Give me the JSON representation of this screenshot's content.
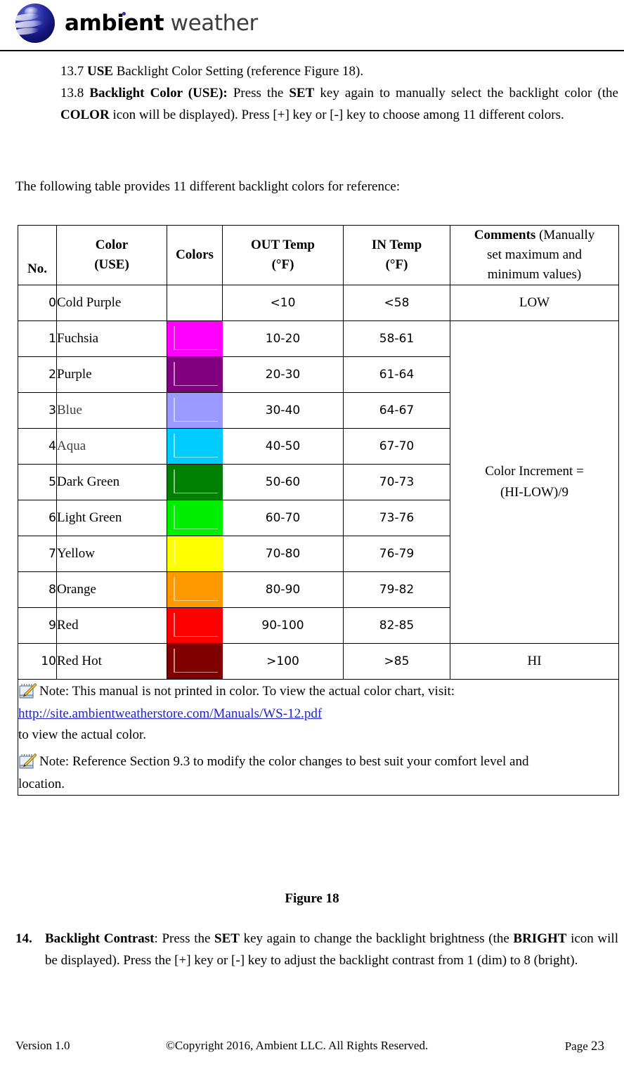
{
  "header": {
    "logo_icon": "ambient-sphere-logo",
    "brand_bold": "ambient",
    "brand_light": " weather"
  },
  "intro": {
    "item_13_7_num": "13.7",
    "item_13_7_bold": "USE",
    "item_13_7_rest": " Backlight Color Setting (reference Figure 18).",
    "item_13_8_num": "13.8",
    "item_13_8_bold": "Backlight Color (USE):",
    "item_13_8_t1": " Press the ",
    "item_13_8_b2": "SET",
    "item_13_8_t2": " key again to manually select the backlight color (the ",
    "item_13_8_b3": "COLOR",
    "item_13_8_t3": " icon will be displayed). Press [+] key or [-] key to choose among 11 different colors.",
    "lead_in": "The following table provides 11 different backlight colors for reference:"
  },
  "table": {
    "headers": {
      "no": "No.",
      "color_line1": "Color",
      "color_line2": "(USE)",
      "colors": "Colors",
      "out_line1": "OUT Temp",
      "out_line2": "(°F)",
      "in_line1": "IN Temp",
      "in_line2": "(°F)",
      "comments_bold": "Comments ",
      "comments_rest_line1": "(Manually",
      "comments_rest_line2": "set maximum and",
      "comments_rest_line3": "minimum values)"
    },
    "rows": [
      {
        "no": "0",
        "name": "Cold Purple",
        "swatch": "",
        "out": "<10",
        "in": "<58",
        "dim": false
      },
      {
        "no": "1",
        "name": "Fuchsia",
        "swatch": "#FF00FF",
        "out": "10-20",
        "in": "58-61",
        "dim": false
      },
      {
        "no": "2",
        "name": "Purple",
        "swatch": "#800080",
        "out": "20-30",
        "in": "61-64",
        "dim": false
      },
      {
        "no": "3",
        "name": "Blue",
        "swatch": "#9999FF",
        "out": "30-40",
        "in": "64-67",
        "dim": true
      },
      {
        "no": "4",
        "name": "Aqua",
        "swatch": "#00CCFF",
        "out": "40-50",
        "in": "67-70",
        "dim": true
      },
      {
        "no": "5",
        "name": "Dark Green",
        "swatch": "#008000",
        "out": "50-60",
        "in": "70-73",
        "dim": false
      },
      {
        "no": "6",
        "name": "Light Green",
        "swatch": "#00EE00",
        "out": "60-70",
        "in": "73-76",
        "dim": false
      },
      {
        "no": "7",
        "name": "Yellow",
        "swatch": "#FFFF00",
        "out": "70-80",
        "in": "76-79",
        "dim": false
      },
      {
        "no": "8",
        "name": "Orange",
        "swatch": "#FF9900",
        "out": "80-90",
        "in": "79-82",
        "dim": false
      },
      {
        "no": "9",
        "name": "Red",
        "swatch": "#FF0000",
        "out": "90-100",
        "in": "82-85",
        "dim": false
      },
      {
        "no": "10",
        "name": "Red Hot",
        "swatch": "#800000",
        "out": ">100",
        "in": ">85",
        "dim": false
      }
    ],
    "comments": {
      "low": "LOW",
      "increment_line1": "Color Increment =",
      "increment_line2": "(HI-LOW)/9",
      "hi": "HI"
    },
    "notes": {
      "note1": "Note: This manual is not printed in color. To view the actual color chart, visit:",
      "note1_link": "http://site.ambientweatherstore.com/Manuals/WS-12.pdf",
      "note1_tail": "to view the actual color.",
      "note2": "Note: Reference Section 9.3 to modify the color changes to best suit your comfort level and",
      "note2_tail": "location."
    }
  },
  "figure_caption": "Figure 18",
  "item14": {
    "marker": "14.",
    "b1": "Backlight Contrast",
    "t1": ": Press the ",
    "b2": "SET",
    "t2": " key again to change the backlight brightness (the ",
    "b3": "BRIGHT",
    "t3": " icon will be displayed).  Press the [+] key or [-] key to adjust the backlight contrast from 1 (dim) to 8 (bright)."
  },
  "footer": {
    "version": "Version 1.0",
    "copyright": "©Copyright 2016, Ambient LLC. All Rights Reserved.",
    "page_label": "Page ",
    "page_number": "23"
  }
}
